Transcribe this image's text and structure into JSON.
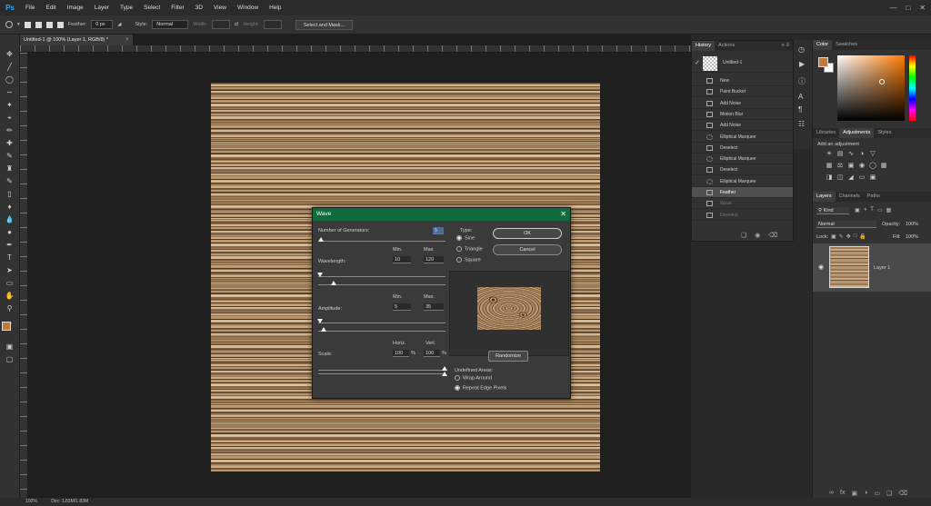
{
  "menubar": {
    "logo": "Ps",
    "items": [
      "File",
      "Edit",
      "Image",
      "Layer",
      "Type",
      "Select",
      "Filter",
      "3D",
      "View",
      "Window",
      "Help"
    ]
  },
  "options": {
    "feather_label": "Feather:",
    "feather_value": "0 px",
    "style_label": "Style:",
    "style_value": "Normal",
    "width_label": "Width:",
    "height_label": "Height:",
    "select_mask": "Select and Mask..."
  },
  "document": {
    "tab_title": "Untitled-1 @ 100% (Layer 1, RGB/8) *"
  },
  "status": {
    "zoom": "100%",
    "doc": "Doc: 1.83M/1.83M"
  },
  "dialog": {
    "title": "Wave",
    "generators_label": "Number of Generators:",
    "generators_value": "5",
    "min_label": "Min.",
    "max_label": "Max.",
    "wavelength_label": "Wavelength:",
    "wavelength_min": "10",
    "wavelength_max": "120",
    "amplitude_label": "Amplitude:",
    "amplitude_min": "5",
    "amplitude_max": "35",
    "scale_label": "Scale:",
    "horiz_label": "Horiz.",
    "vert_label": "Vert.",
    "scale_horiz": "100",
    "scale_vert": "100",
    "percent": "%",
    "type_label": "Type:",
    "type_options": [
      "Sine",
      "Triangle",
      "Square"
    ],
    "type_selected": "Sine",
    "ok": "OK",
    "cancel": "Cancel",
    "randomize": "Randomize",
    "undefined_label": "Undefined Areas:",
    "undefined_options": [
      "Wrap Around",
      "Repeat Edge Pixels"
    ],
    "undefined_selected": "Repeat Edge Pixels"
  },
  "history_panel": {
    "tabs": [
      "History",
      "Actions"
    ],
    "snapshot": "Untitled-1",
    "items": [
      "New",
      "Paint Bucket",
      "Add Noise",
      "Motion Blur",
      "Add Noise",
      "Elliptical Marquee",
      "Deselect",
      "Elliptical Marquee",
      "Deselect",
      "Elliptical Marquee",
      "Feather",
      "Wave",
      "Deselect"
    ],
    "active_index": 10
  },
  "color_panel": {
    "tabs": [
      "Color",
      "Swatches"
    ],
    "fg_color": "#c27a3b",
    "bg_color": "#ffffff"
  },
  "adjust_panel": {
    "tabs": [
      "Libraries",
      "Adjustments",
      "Styles"
    ],
    "heading": "Add an adjustment"
  },
  "layers_panel": {
    "tabs": [
      "Layers",
      "Channels",
      "Paths"
    ],
    "kind": "Kind",
    "blend_mode": "Normal",
    "opacity_label": "Opacity:",
    "opacity": "100%",
    "lock_label": "Lock:",
    "fill_label": "Fill:",
    "fill": "100%",
    "layer_name": "Layer 1"
  }
}
